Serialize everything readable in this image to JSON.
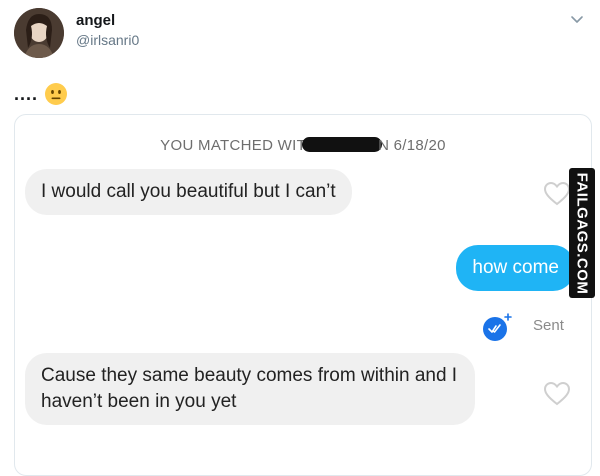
{
  "tweet": {
    "display_name": "angel",
    "handle": "@irlsanri0",
    "text": "....",
    "emoji": "neutral-face-emoji",
    "menu_icon": "chevron-down-icon"
  },
  "chat": {
    "matched_prefix": "YOU MATCHED WIT",
    "matched_suffix": "N 6/18/20",
    "messages": [
      {
        "side": "left",
        "text": "I would call you beautiful but I can’t"
      },
      {
        "side": "right",
        "text": "how come"
      },
      {
        "side": "left",
        "text": "Cause they same beauty comes from within and I haven’t been in you yet"
      }
    ],
    "status": "Sent",
    "status_icon": "read-receipt-icon"
  },
  "watermark": "FAILGAGS.COM",
  "colors": {
    "sent_bubble": "#1fb4f5",
    "received_bubble": "#f0f0f0",
    "read_icon": "#1a73e8"
  }
}
